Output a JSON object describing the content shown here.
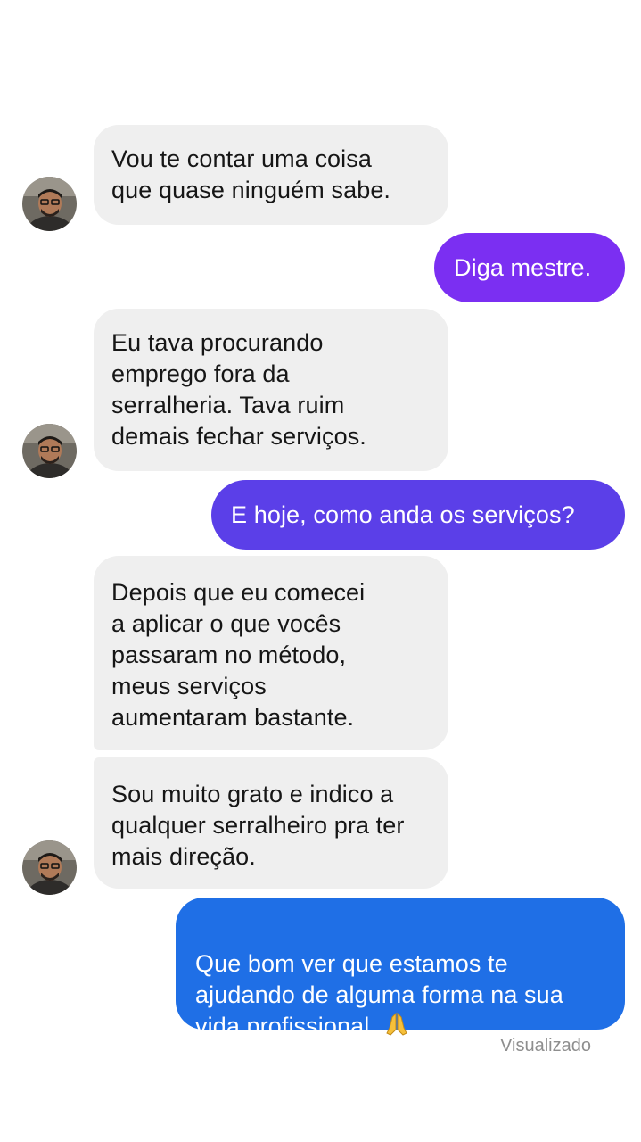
{
  "conversation": {
    "messages": [
      {
        "sender": "contact",
        "text": "Vou te contar uma coisa\nque quase ninguém sabe."
      },
      {
        "sender": "me",
        "text": "Diga mestre."
      },
      {
        "sender": "contact",
        "text": "Eu tava procurando\nemprego fora da\nserralheria. Tava ruim\ndemais fechar serviços."
      },
      {
        "sender": "me",
        "text": "E hoje, como anda os serviços?"
      },
      {
        "sender": "contact",
        "text": "Depois que eu comecei\na aplicar o que vocês\npassaram no método,\nmeus serviços\naumentaram bastante."
      },
      {
        "sender": "contact",
        "text": "Sou muito grato e indico a\nqualquer serralheiro pra ter\nmais direção."
      },
      {
        "sender": "me",
        "text": "Que bom ver que estamos te\najudando de alguma forma na sua\nvida profissional.",
        "emoji": "folded-hands-icon"
      }
    ],
    "seen_status": "Visualizado"
  },
  "colors": {
    "incoming_bubble": "#efefef",
    "outgoing_purple": "#7b2ff2",
    "outgoing_indigo": "#5b3fe8",
    "outgoing_blue": "#1f6fe6",
    "seen_text": "#8e8e8e"
  }
}
